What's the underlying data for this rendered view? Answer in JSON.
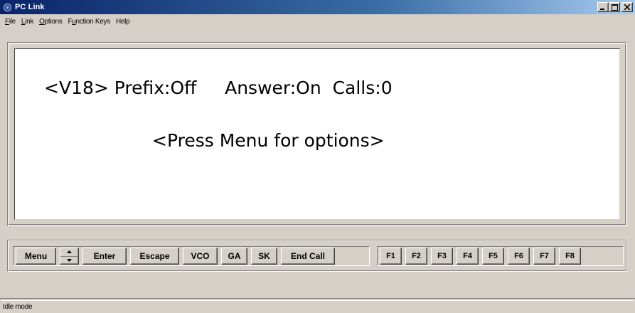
{
  "window": {
    "title": "PC Link",
    "icon": "pc-link-app-icon",
    "controls": {
      "minimize": "_",
      "maximize": "□",
      "close": "×"
    }
  },
  "menubar": {
    "items": [
      {
        "label": "File",
        "underline": "F"
      },
      {
        "label": "Link",
        "underline": "L"
      },
      {
        "label": "Options",
        "underline": "O"
      },
      {
        "label": "Function Keys",
        "underline": "u"
      },
      {
        "label": "Help",
        "underline": ""
      }
    ]
  },
  "display": {
    "line1": "<V18> Prefix:Off     Answer:On  Calls:0",
    "line2": "<Press Menu for options>"
  },
  "toolbar": {
    "menu_label": "Menu",
    "spinner_icon": "up-down-spinner-icon",
    "enter_label": "Enter",
    "escape_label": "Escape",
    "vco_label": "VCO",
    "ga_label": "GA",
    "sk_label": "SK",
    "end_call_label": "End Call",
    "function_keys": [
      "F1",
      "F2",
      "F3",
      "F4",
      "F5",
      "F6",
      "F7",
      "F8"
    ]
  },
  "statusbar": {
    "text": "Idle mode"
  },
  "colors": {
    "titlebar_start": "#0a246a",
    "titlebar_end": "#a6caf0",
    "face": "#d4d0c8",
    "screen": "#ffffff"
  }
}
